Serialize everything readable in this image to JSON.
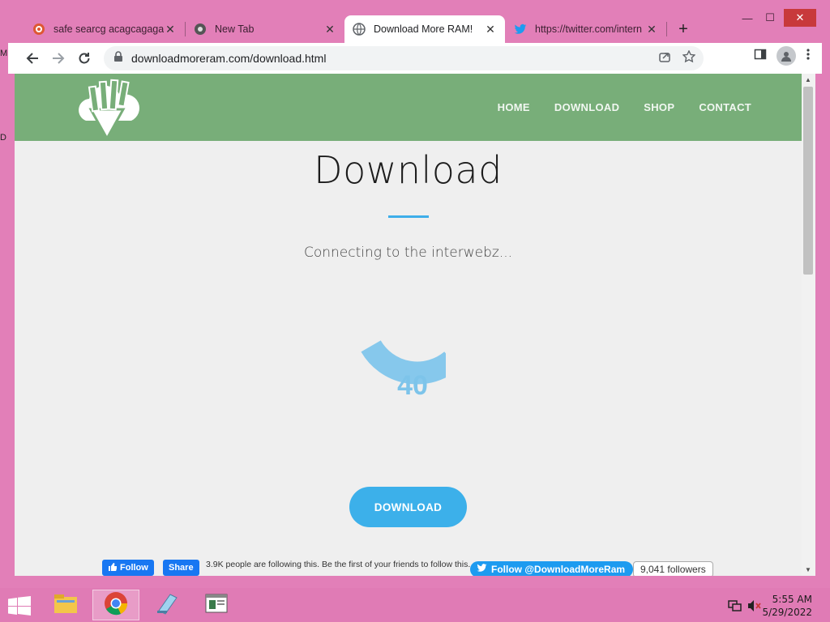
{
  "desktop": {
    "edge_labels": [
      "M",
      "D"
    ]
  },
  "browser": {
    "tabs": [
      {
        "title": "safe searcg acagcagagag",
        "icon": "duckduckgo-icon",
        "active": false
      },
      {
        "title": "New Tab",
        "icon": "chrome-icon",
        "active": false
      },
      {
        "title": "Download More RAM!",
        "icon": "globe-icon",
        "active": true
      },
      {
        "title": "https://twitter.com/intern",
        "icon": "twitter-icon",
        "active": false
      }
    ],
    "new_tab_label": "+",
    "window_controls": {
      "minimize": "—",
      "maximize": "☐",
      "close": "✕"
    },
    "address": "downloadmoreram.com/download.html"
  },
  "site": {
    "nav": [
      "HOME",
      "DOWNLOAD",
      "SHOP",
      "CONTACT"
    ],
    "title": "Download",
    "status": "Connecting to the interwebz...",
    "gauge_value": "40",
    "gauge_percent": 40,
    "download_button": "DOWNLOAD",
    "accent": "#3cb0ea",
    "header_color": "#78ae79"
  },
  "social": {
    "fb_follow": "Follow",
    "fb_share": "Share",
    "fb_text": "3.9K people are following this. Be the first of your friends to follow this.",
    "tw_follow": "Follow @DownloadMoreRam",
    "tw_followers": "9,041 followers"
  },
  "taskbar": {
    "time": "5:55 AM",
    "date": "5/29/2022"
  }
}
